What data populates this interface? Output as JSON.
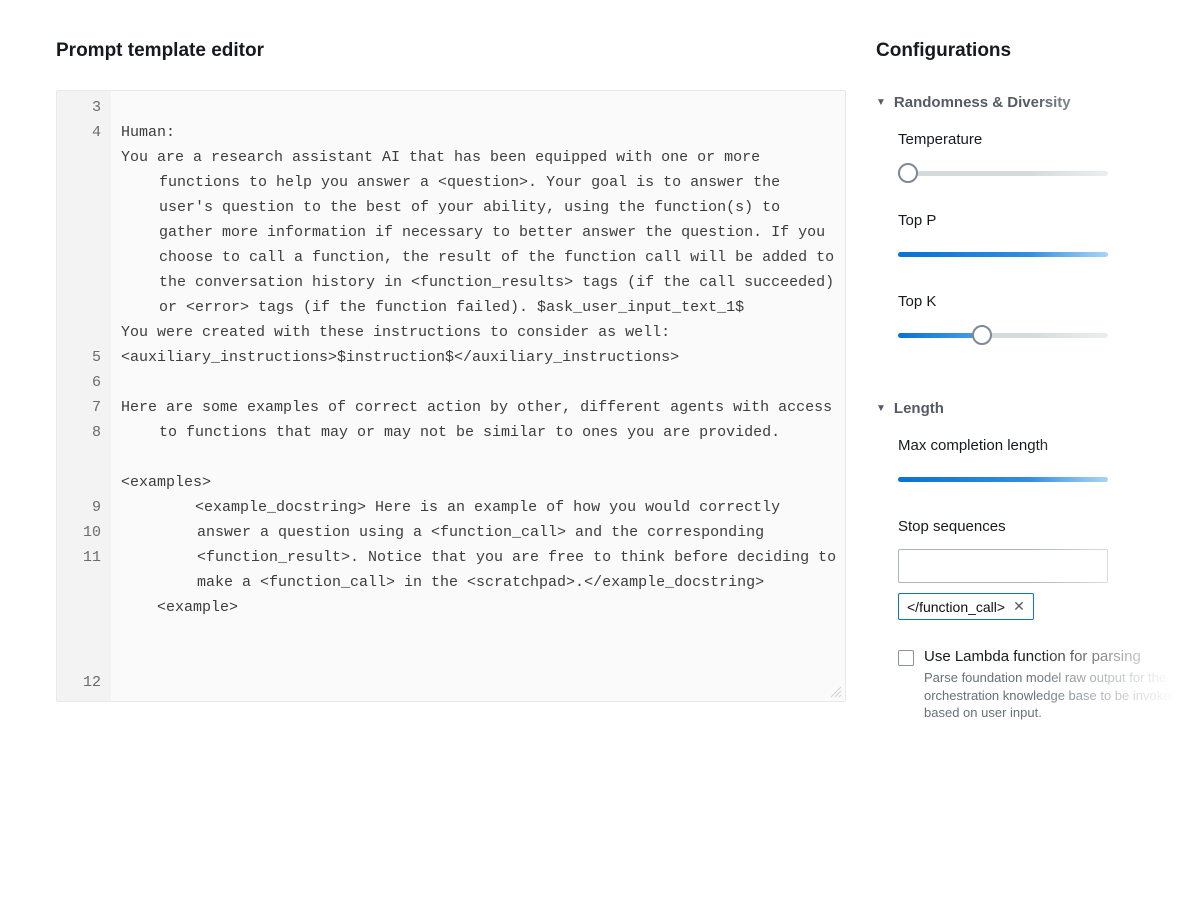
{
  "left": {
    "title": "Prompt template editor",
    "lines": [
      {
        "num": 3,
        "text": "Human:"
      },
      {
        "num": 4,
        "text": "You are a research assistant AI that has been equipped with one or more functions to help you answer a <question>. Your goal is to answer the user's question to the best of your ability, using the function(s) to gather more information if necessary to better answer the question. If you choose to call a function, the result of the function call will be added to the conversation history in <function_results> tags (if the call succeeded) or <error> tags (if the function failed). $ask_user_input_text_1$"
      },
      {
        "num": 5,
        "text": "You were created with these instructions to consider as well:"
      },
      {
        "num": 6,
        "text": "<auxiliary_instructions>$instruction$</auxiliary_instructions>"
      },
      {
        "num": 7,
        "text": ""
      },
      {
        "num": 8,
        "text": "Here are some examples of correct action by other, different agents with access to functions that may or may not be similar to ones you are provided."
      },
      {
        "num": 9,
        "text": ""
      },
      {
        "num": 10,
        "text": "<examples>"
      },
      {
        "num": 11,
        "text": "    <example_docstring> Here is an example of how you would correctly answer a question using a <function_call> and the corresponding <function_result>. Notice that you are free to think before deciding to make a <function_call> in the <scratchpad>.</example_docstring>"
      },
      {
        "num": 12,
        "text": "    <example>"
      }
    ]
  },
  "right": {
    "title": "Configurations",
    "sections": {
      "randomness": {
        "header": "Randomness & Diversity",
        "temperature": {
          "label": "Temperature",
          "value_pct": 2
        },
        "top_p": {
          "label": "Top P",
          "value_pct": 100
        },
        "top_k": {
          "label": "Top K",
          "value_pct": 40
        }
      },
      "length": {
        "header": "Length",
        "max_completion": {
          "label": "Max completion length",
          "value_pct": 100
        },
        "stop_sequences": {
          "label": "Stop sequences",
          "input_value": "",
          "chips": [
            "</function_call>"
          ]
        }
      },
      "lambda": {
        "label": "Use Lambda function for parsing",
        "sub": "Parse foundation model raw output for the orchestration knowledge base to be invoked based on user input."
      }
    }
  }
}
